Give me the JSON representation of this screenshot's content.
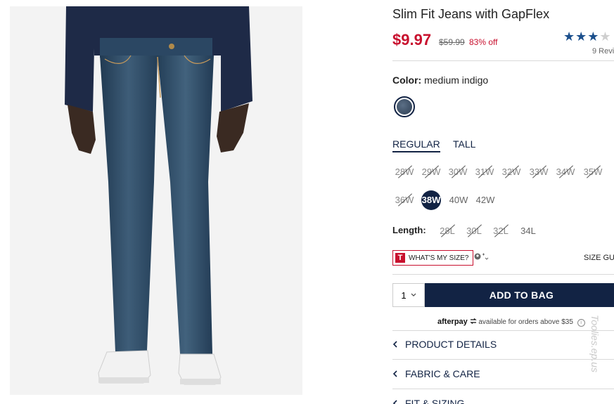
{
  "product": {
    "title": "Slim Fit Jeans with GapFlex",
    "price": "$9.97",
    "was_price": "$59.99",
    "discount": "83% off",
    "stars_on": "★★★",
    "stars_off": "★",
    "reviews": "9 Revi"
  },
  "color": {
    "label": "Color:",
    "value": "medium indigo"
  },
  "fit_tabs": [
    "REGULAR",
    "TALL"
  ],
  "waist_sizes": [
    "28W",
    "29W",
    "30W",
    "31W",
    "32W",
    "33W",
    "34W",
    "35W",
    "36W",
    "38W",
    "40W",
    "42W"
  ],
  "selected_waist": "38W",
  "length": {
    "label": "Length:",
    "options": [
      "28L",
      "30L",
      "32L",
      "34L"
    ]
  },
  "size_tools": {
    "whats_my_size": "WHAT'S MY SIZE?",
    "badge": "T",
    "size_guide": "SIZE GU"
  },
  "purchase": {
    "quantity": "1",
    "add_to_bag": "ADD TO BAG"
  },
  "afterpay": {
    "logo": "afterpay",
    "text": "available for orders above $35",
    "info": "i"
  },
  "accordion": [
    "PRODUCT DETAILS",
    "FABRIC & CARE",
    "FIT & SIZING"
  ],
  "watermark": "Toolies.ep.us",
  "colors": {
    "brand_navy": "#122344",
    "sale_red": "#c8102e",
    "star_blue": "#1b4f8c",
    "denim": "#2f4a63"
  }
}
